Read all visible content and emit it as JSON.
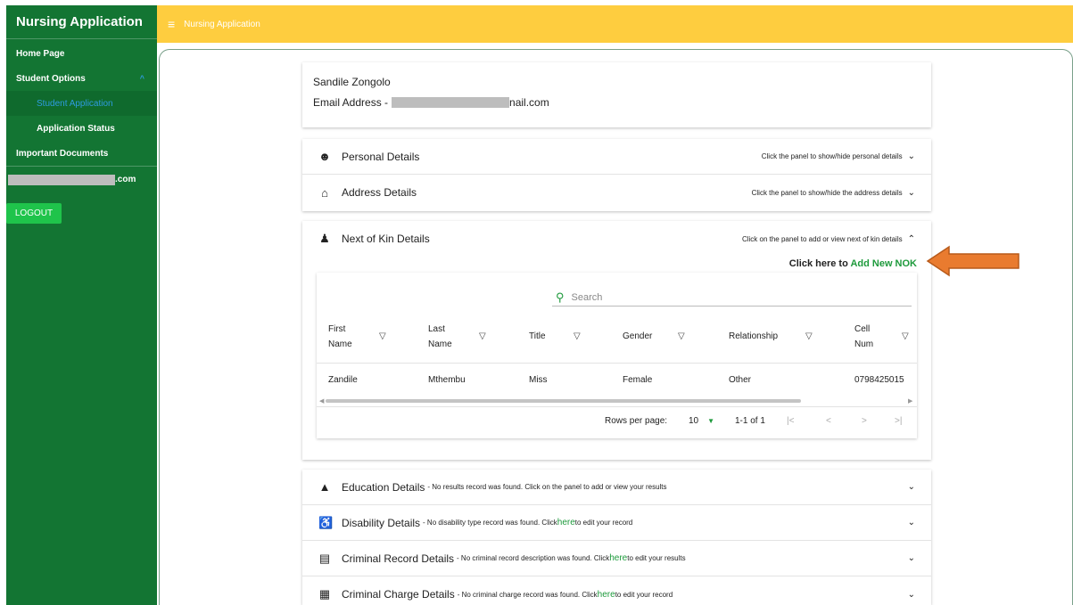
{
  "sidebar": {
    "title": "Nursing Application",
    "items": [
      {
        "label": "Home Page"
      },
      {
        "label": "Student Options",
        "chevron": "^"
      },
      {
        "label": "Student Application"
      },
      {
        "label": "Application Status"
      },
      {
        "label": "Important Documents"
      }
    ],
    "user_suffix": ".com",
    "logout": "LOGOUT"
  },
  "topbar": {
    "title": "Nursing Application",
    "menu_icon": "≡"
  },
  "profile": {
    "name": "Sandile Zongolo",
    "email_prefix": "Email Address - ",
    "email_suffix": "nail.com"
  },
  "panels": {
    "personal": {
      "title": "Personal Details",
      "hint": "Click the panel to show/hide personal details"
    },
    "address": {
      "title": "Address Details",
      "hint": "Click the panel to show/hide the address details"
    },
    "nok": {
      "title": "Next of Kin Details",
      "hint": "Click on the panel to add or view next of kin details",
      "add_prefix": "Click here to ",
      "add_link": "Add New NOK"
    }
  },
  "table": {
    "search_placeholder": "Search",
    "headers": [
      [
        "First",
        "Name"
      ],
      [
        "Last",
        "Name"
      ],
      [
        "Title",
        ""
      ],
      [
        "Gender",
        ""
      ],
      [
        "Relationship",
        ""
      ],
      [
        "Cell",
        "Num"
      ]
    ],
    "row": [
      "Zandile",
      "Mthembu",
      "Miss",
      "Female",
      "Other",
      "0798425015"
    ],
    "rows_per_page_label": "Rows per page:",
    "rows_per_page": "10",
    "range": "1-1 of 1"
  },
  "lower_panels": [
    {
      "title": "Education Details",
      "note": " - No results record was found. Click on the panel to add or view your results",
      "link": "",
      "tail": ""
    },
    {
      "title": "Disability Details",
      "note": " - No disability type record was found. Click ",
      "link": "here",
      "tail": " to edit your record"
    },
    {
      "title": "Criminal Record Details",
      "note": " - No criminal record description was found. Click ",
      "link": "here",
      "tail": " to edit your results"
    },
    {
      "title": "Criminal Charge Details",
      "note": " - No criminal charge record was found. Click ",
      "link": "here",
      "tail": " to edit your record"
    }
  ],
  "colors": {
    "sidebar": "#137533",
    "topbar": "#fecd3f",
    "accent": "#1e9a3c",
    "arrow": "#e97b2f"
  }
}
